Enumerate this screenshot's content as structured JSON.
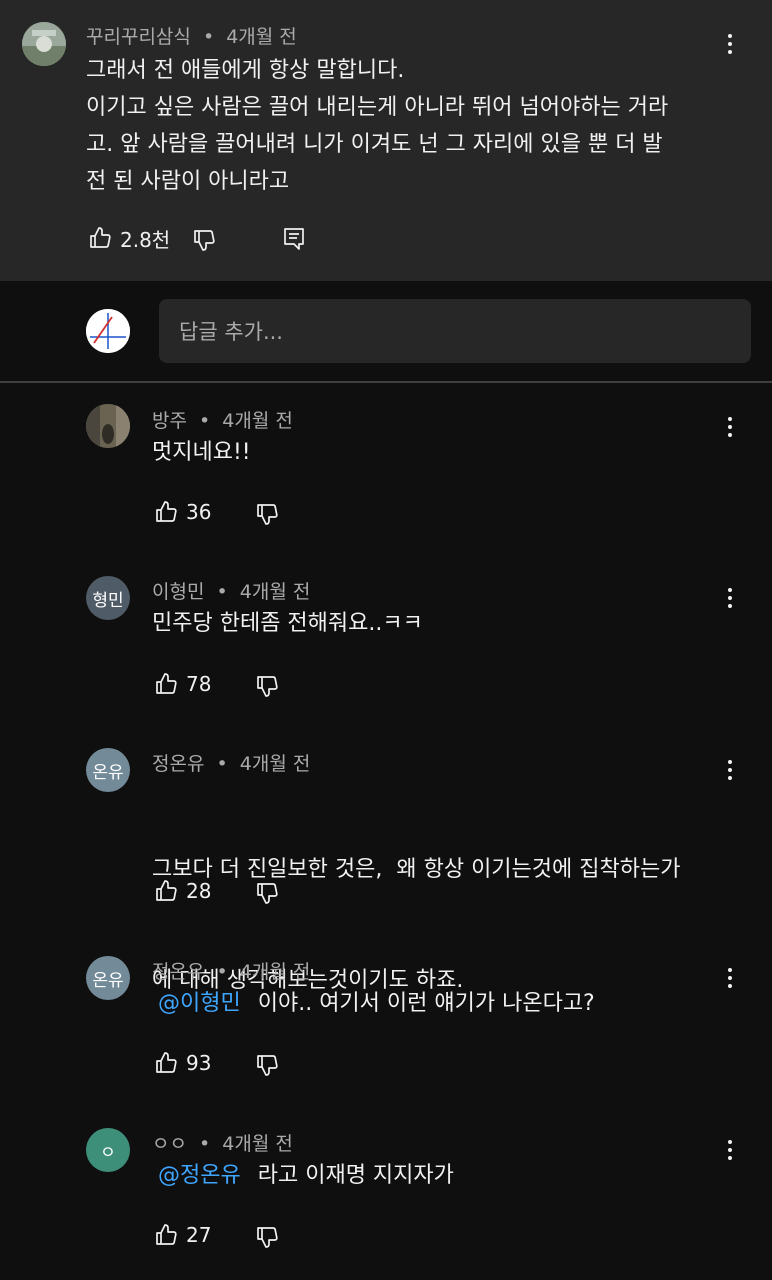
{
  "top_comment": {
    "author": "꾸리꾸리삼식",
    "time": "4개월 전",
    "lines": [
      "그래서 전 애들에게 항상 말합니다.",
      "이기고 싶은 사람은 끌어 내리는게 아니라 뛰어 넘어야하는 거라",
      "고. 앞 사람을 끌어내려 니가 이겨도 넌 그 자리에 있을 뿐 더 발",
      "전 된 사람이 아니라고"
    ],
    "likes": "2.8천"
  },
  "reply_box": {
    "placeholder": "답글 추가..."
  },
  "replies": [
    {
      "author": "방주",
      "time": "4개월 전",
      "lines": [
        "멋지네요!!"
      ],
      "likes": "36",
      "avatar_text": ""
    },
    {
      "author": "이형민",
      "time": "4개월 전",
      "lines": [
        "민주당 한테좀 전해줘요..ㅋㅋ"
      ],
      "likes": "78",
      "avatar_text": "형민",
      "avatar_color": "#4f5b66"
    },
    {
      "author": "정온유",
      "time": "4개월 전",
      "lines": [
        "그보다 더 진일보한 것은,  왜 항상 이기는것에 집착하는가",
        "에 대해 생각해보는것이기도 하죠."
      ],
      "likes": "28",
      "avatar_text": "온유",
      "avatar_color": "#738a99"
    },
    {
      "author": "정온유",
      "time": "4개월 전",
      "mention": "@이형민",
      "lines": [
        "이야.. 여기서 이런 얘기가 나온다고?"
      ],
      "likes": "93",
      "avatar_text": "온유",
      "avatar_color": "#738a99"
    },
    {
      "author": "ㅇㅇ",
      "time": "4개월 전",
      "mention": "@정온유",
      "lines": [
        "라고 이재명 지지자가"
      ],
      "likes": "27",
      "avatar_text": "ㅇ",
      "avatar_color": "#3d8f7a"
    }
  ],
  "meta_separator": "•"
}
